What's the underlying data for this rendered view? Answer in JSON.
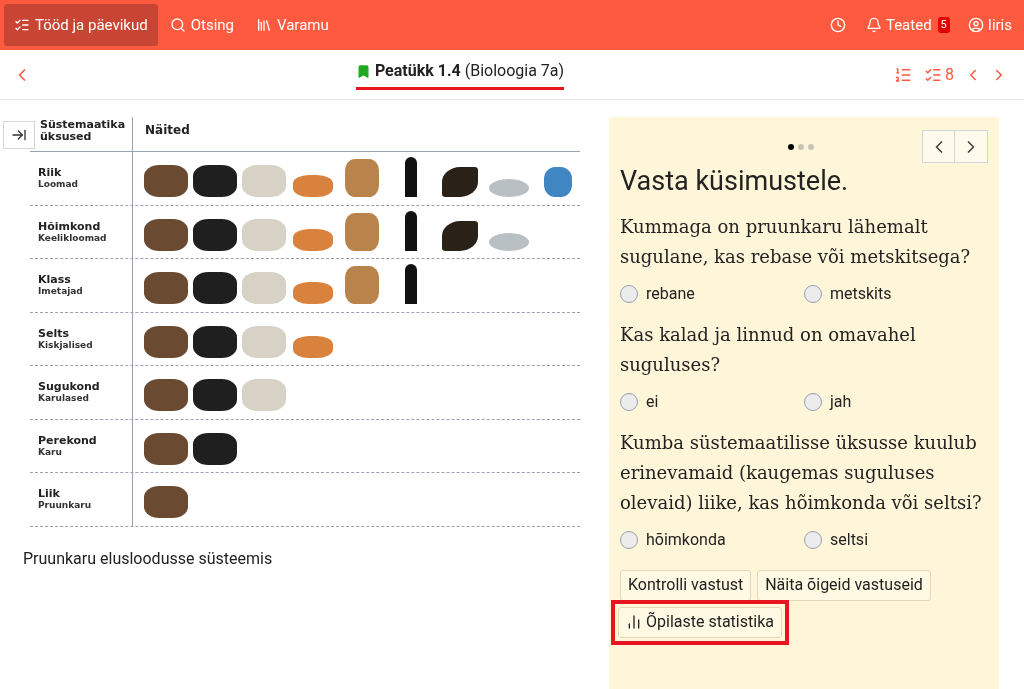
{
  "nav": {
    "items": [
      {
        "kind": "tasks",
        "label": "Tööd ja päevikud",
        "selected": true
      },
      {
        "kind": "search",
        "label": "Otsing",
        "selected": false
      },
      {
        "kind": "library",
        "label": "Varamu",
        "selected": false
      }
    ],
    "notifications": {
      "label": "Teated",
      "count": "5"
    },
    "user": {
      "label": "Iiris"
    }
  },
  "header": {
    "title": "Peatükk 1.4",
    "subtitle": "(Bioloogia 7a)",
    "bookmarked": true,
    "highlighted": true,
    "task_count": "8"
  },
  "figure": {
    "columns": [
      "Süstemaatika üksused",
      "Näited"
    ],
    "rows": [
      {
        "name": "Riik",
        "latin": "Loomad",
        "examples": [
          {
            "kind": "brown-bear"
          },
          {
            "kind": "black-bear"
          },
          {
            "kind": "panda"
          },
          {
            "kind": "fox"
          },
          {
            "kind": "deer"
          },
          {
            "kind": "human"
          },
          {
            "kind": "eagle"
          },
          {
            "kind": "fish"
          },
          {
            "kind": "butterfly"
          }
        ]
      },
      {
        "name": "Hõimkond",
        "latin": "Keelikloomad",
        "examples": [
          {
            "kind": "brown-bear"
          },
          {
            "kind": "black-bear"
          },
          {
            "kind": "panda"
          },
          {
            "kind": "fox"
          },
          {
            "kind": "deer"
          },
          {
            "kind": "human"
          },
          {
            "kind": "eagle"
          },
          {
            "kind": "fish"
          }
        ]
      },
      {
        "name": "Klass",
        "latin": "Imetajad",
        "examples": [
          {
            "kind": "brown-bear"
          },
          {
            "kind": "black-bear"
          },
          {
            "kind": "panda"
          },
          {
            "kind": "fox"
          },
          {
            "kind": "deer"
          },
          {
            "kind": "human"
          }
        ]
      },
      {
        "name": "Selts",
        "latin": "Kiskjalised",
        "examples": [
          {
            "kind": "brown-bear"
          },
          {
            "kind": "black-bear"
          },
          {
            "kind": "panda"
          },
          {
            "kind": "fox"
          }
        ]
      },
      {
        "name": "Sugukond",
        "latin": "Karulased",
        "examples": [
          {
            "kind": "brown-bear"
          },
          {
            "kind": "black-bear"
          },
          {
            "kind": "panda"
          }
        ]
      },
      {
        "name": "Perekond",
        "latin": "Karu",
        "examples": [
          {
            "kind": "brown-bear"
          },
          {
            "kind": "black-bear"
          }
        ]
      },
      {
        "name": "Liik",
        "latin": "Pruunkaru",
        "examples": [
          {
            "kind": "brown-bear"
          }
        ]
      }
    ],
    "caption": "Pruunkaru elusloodusse süsteemis"
  },
  "quiz": {
    "pages": [
      {
        "selected": true
      },
      {
        "selected": false
      },
      {
        "selected": false
      }
    ],
    "title": "Vasta küsimustele.",
    "questions": [
      {
        "text": "Kummaga on pruunkaru lähemalt sugulane, kas rebase või metskitsega?",
        "options": [
          {
            "label": "rebane",
            "selected": false
          },
          {
            "label": "metskits",
            "selected": false
          }
        ]
      },
      {
        "text": "Kas kalad ja linnud on omavahel suguluses?",
        "options": [
          {
            "label": "ei",
            "selected": false
          },
          {
            "label": "jah",
            "selected": false
          }
        ]
      },
      {
        "text": "Kumba süstemaatilisse üksusse kuulub erinevamaid (kaugemas suguluses olevaid) liike, kas hõimkonda või seltsi?",
        "options": [
          {
            "label": "hõimkonda",
            "selected": false
          },
          {
            "label": "seltsi",
            "selected": false
          }
        ]
      }
    ],
    "buttons": [
      {
        "kind": "check",
        "label": "Kontrolli vastust",
        "highlighted": false
      },
      {
        "kind": "answers",
        "label": "Näita õigeid vastuseid",
        "highlighted": false
      },
      {
        "kind": "stats",
        "label": "Õpilaste statistika",
        "highlighted": true
      }
    ]
  }
}
